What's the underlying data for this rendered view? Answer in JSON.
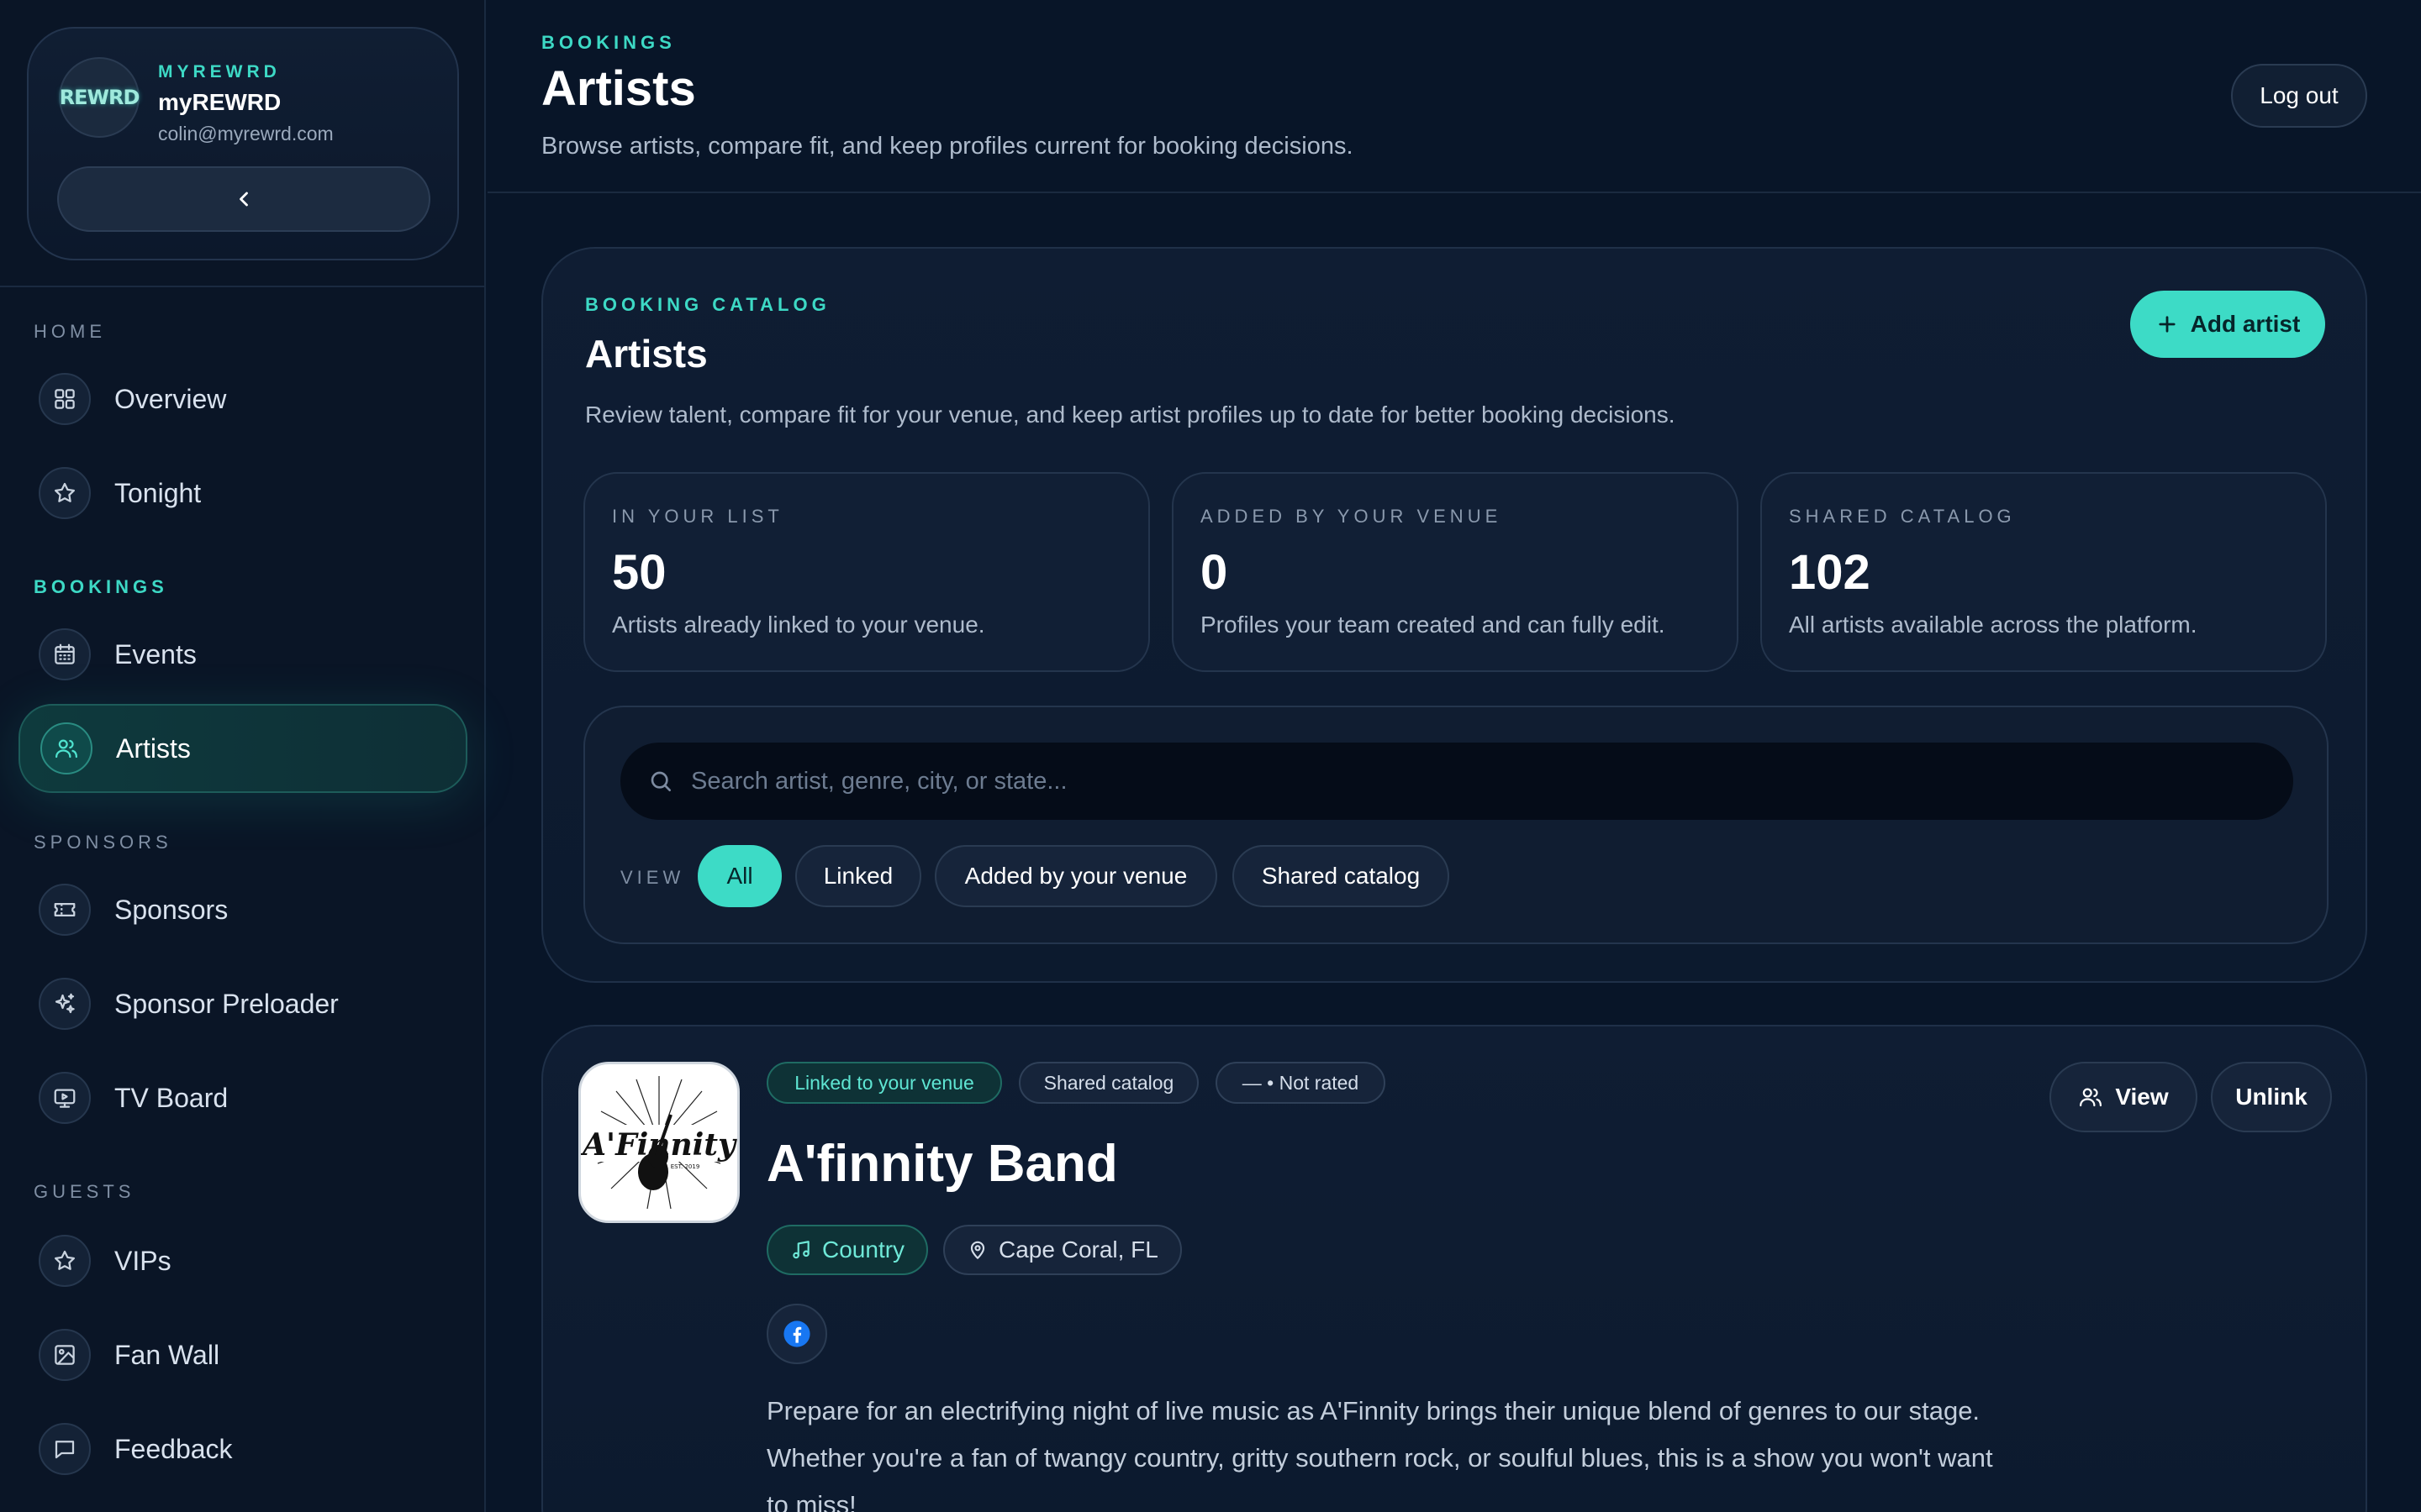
{
  "brand": {
    "logo_text": "REWRD",
    "eyebrow": "MYREWRD",
    "name": "myREWRD",
    "email": "colin@myrewrd.com"
  },
  "sidebar": {
    "sections": [
      {
        "label": "HOME",
        "items": [
          {
            "label": "Overview",
            "icon": "grid-icon"
          },
          {
            "label": "Tonight",
            "icon": "star-icon"
          }
        ]
      },
      {
        "label": "BOOKINGS",
        "items": [
          {
            "label": "Events",
            "icon": "calendar-icon"
          },
          {
            "label": "Artists",
            "icon": "users-icon",
            "active": true
          }
        ]
      },
      {
        "label": "SPONSORS",
        "items": [
          {
            "label": "Sponsors",
            "icon": "ticket-icon"
          },
          {
            "label": "Sponsor Preloader",
            "icon": "sparkles-icon"
          },
          {
            "label": "TV Board",
            "icon": "tv-icon"
          }
        ]
      },
      {
        "label": "GUESTS",
        "items": [
          {
            "label": "VIPs",
            "icon": "star-icon"
          },
          {
            "label": "Fan Wall",
            "icon": "image-icon"
          },
          {
            "label": "Feedback",
            "icon": "message-icon"
          }
        ]
      }
    ]
  },
  "header": {
    "eyebrow": "BOOKINGS",
    "title": "Artists",
    "subtitle": "Browse artists, compare fit, and keep profiles current for booking decisions.",
    "logout_label": "Log out"
  },
  "catalog": {
    "eyebrow": "BOOKING CATALOG",
    "title": "Artists",
    "subtitle": "Review talent, compare fit for your venue, and keep artist profiles up to date for better booking decisions.",
    "add_label": "Add artist",
    "stats": [
      {
        "label": "IN YOUR LIST",
        "value": "50",
        "desc": "Artists already linked to your venue."
      },
      {
        "label": "ADDED BY YOUR VENUE",
        "value": "0",
        "desc": "Profiles your team created and can fully edit."
      },
      {
        "label": "SHARED CATALOG",
        "value": "102",
        "desc": "All artists available across the platform."
      }
    ],
    "search_placeholder": "Search artist, genre, city, or state...",
    "view_label": "VIEW",
    "filters": [
      "All",
      "Linked",
      "Added by your venue",
      "Shared catalog"
    ],
    "active_filter": "All"
  },
  "artist": {
    "badges": [
      "Linked to your venue",
      "Shared catalog",
      "— • Not rated"
    ],
    "name": "A'finnity Band",
    "logo_script": "A'Finnity",
    "logo_small": "EST. 2019",
    "genre": "Country",
    "location": "Cape Coral, FL",
    "view_label": "View",
    "unlink_label": "Unlink",
    "description": "Prepare for an electrifying night of live music as A'Finnity brings their unique blend of genres to our stage. Whether you're a fan of twangy country, gritty southern rock, or soulful blues, this is a show you won't want to miss!"
  },
  "colors": {
    "accent": "#3ddbc6",
    "background": "#081528",
    "facebook": "#1877f2"
  }
}
